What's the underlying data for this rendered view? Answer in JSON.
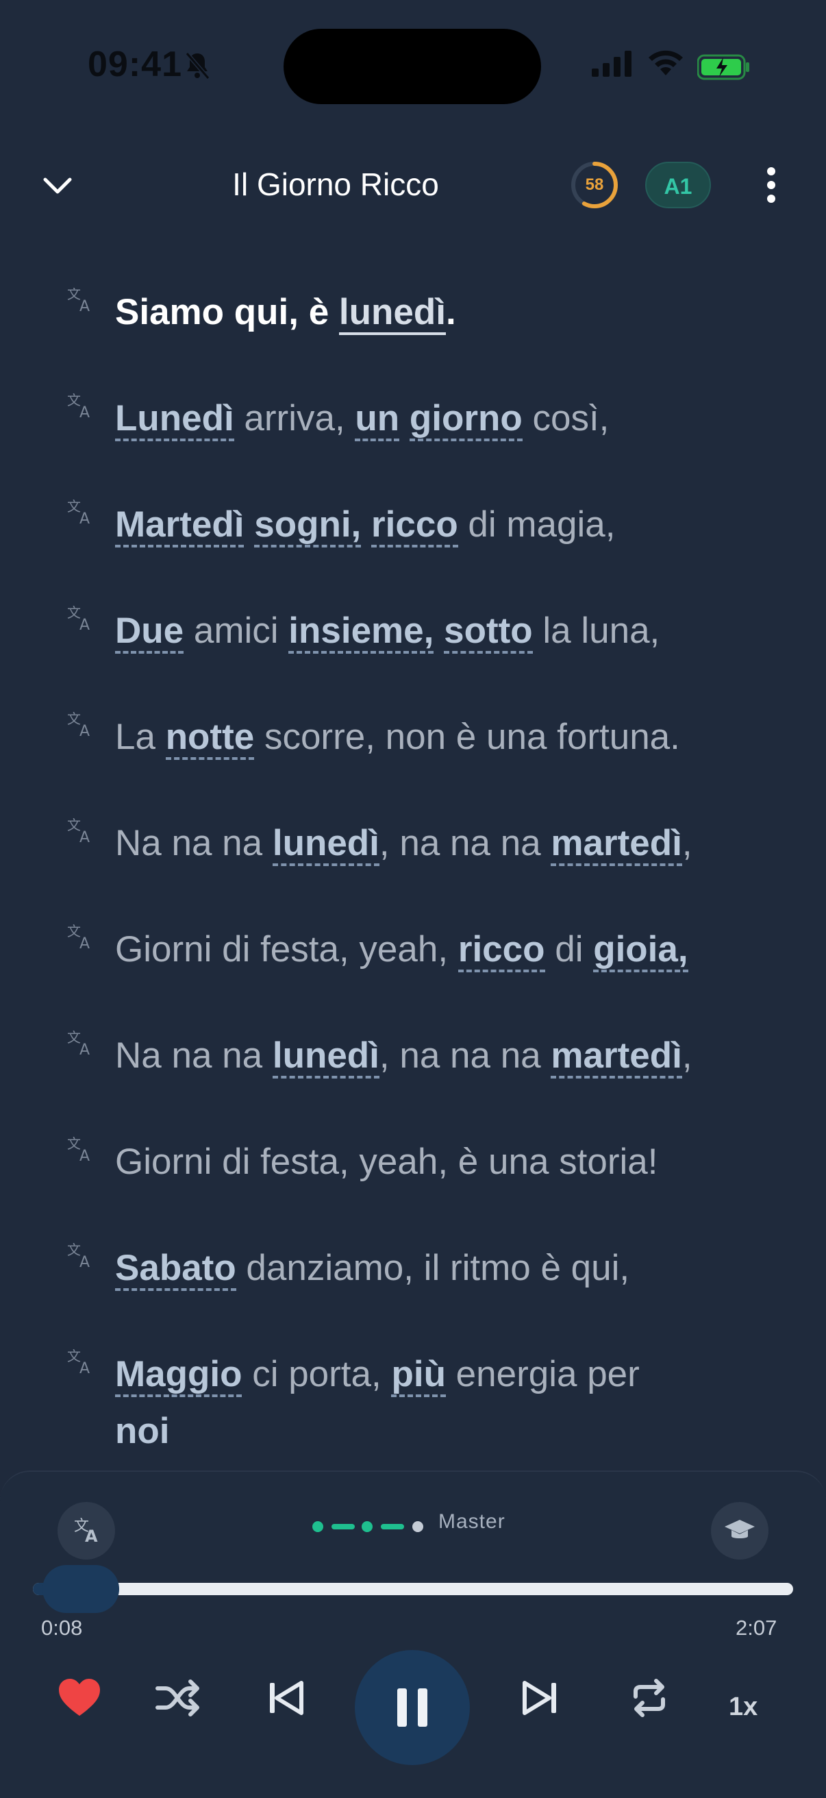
{
  "status": {
    "time": "09:41"
  },
  "header": {
    "title": "Il Giorno Ricco",
    "score": "58",
    "score_progress": 0.58,
    "level": "A1"
  },
  "lyrics": [
    {
      "active": true,
      "segments": [
        {
          "t": "Siamo qui, è ",
          "h": false
        },
        {
          "t": "lunedì",
          "h": true
        },
        {
          "t": ".",
          "h": false
        }
      ]
    },
    {
      "segments": [
        {
          "t": "Lunedì",
          "h": true
        },
        {
          "t": " arriva, ",
          "h": false
        },
        {
          "t": "un",
          "h": true
        },
        {
          "t": " ",
          "h": false
        },
        {
          "t": "giorno",
          "h": true
        },
        {
          "t": " così,",
          "h": false
        }
      ]
    },
    {
      "segments": [
        {
          "t": "Martedì",
          "h": true
        },
        {
          "t": " ",
          "h": false
        },
        {
          "t": "sogni,",
          "h": true
        },
        {
          "t": " ",
          "h": false
        },
        {
          "t": "ricco",
          "h": true
        },
        {
          "t": " di magia,",
          "h": false
        }
      ]
    },
    {
      "segments": [
        {
          "t": "Due",
          "h": true
        },
        {
          "t": " amici ",
          "h": false
        },
        {
          "t": "insieme,",
          "h": true
        },
        {
          "t": " ",
          "h": false
        },
        {
          "t": "sotto",
          "h": true
        },
        {
          "t": " la luna,",
          "h": false
        }
      ]
    },
    {
      "segments": [
        {
          "t": "La ",
          "h": false
        },
        {
          "t": "notte",
          "h": true
        },
        {
          "t": " scorre, non è una fortuna.",
          "h": false
        }
      ]
    },
    {
      "segments": [
        {
          "t": "Na na na ",
          "h": false
        },
        {
          "t": "lunedì",
          "h": true
        },
        {
          "t": ", na na na ",
          "h": false
        },
        {
          "t": "martedì",
          "h": true
        },
        {
          "t": ",",
          "h": false
        }
      ]
    },
    {
      "segments": [
        {
          "t": "Giorni di festa, yeah, ",
          "h": false
        },
        {
          "t": "ricco",
          "h": true
        },
        {
          "t": " di ",
          "h": false
        },
        {
          "t": "gioia,",
          "h": true
        }
      ]
    },
    {
      "segments": [
        {
          "t": "Na na na ",
          "h": false
        },
        {
          "t": "lunedì",
          "h": true
        },
        {
          "t": ", na na na ",
          "h": false
        },
        {
          "t": "martedì",
          "h": true
        },
        {
          "t": ",",
          "h": false
        }
      ]
    },
    {
      "segments": [
        {
          "t": "Giorni di festa, yeah, è una storia!",
          "h": false
        }
      ]
    },
    {
      "segments": [
        {
          "t": "Sabato",
          "h": true
        },
        {
          "t": " danziamo, il ritmo è qui,",
          "h": false
        }
      ]
    },
    {
      "segments": [
        {
          "t": "Maggio",
          "h": true
        },
        {
          "t": " ci porta, ",
          "h": false
        },
        {
          "t": "più",
          "h": true
        },
        {
          "t": " energia per",
          "h": false
        }
      ],
      "wrap": "noi"
    }
  ],
  "player": {
    "mode_label": "Master",
    "current_time": "0:08",
    "total_time": "2:07",
    "progress": 0.063,
    "speed": "1x",
    "favorite_color": "#ef4444",
    "accent_color": "#1fbf8f"
  }
}
